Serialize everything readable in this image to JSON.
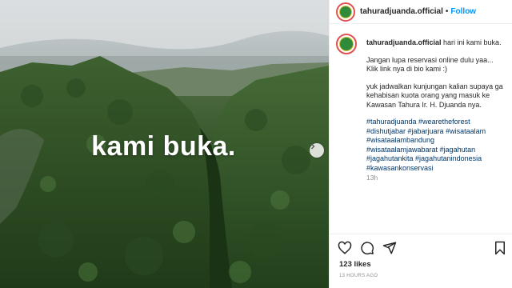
{
  "post": {
    "username": "tahuradjuanda.official",
    "follow_label": "Follow",
    "dot": "•",
    "overlay_text": "kami buka.",
    "caption": {
      "line1": "hari ini kami buka.",
      "para2": "Jangan lupa reservasi online dulu yaa... Klik link nya di bio kami :)",
      "para3": "yuk jadwalkan kunjungan kalian supaya ga kehabisan kuota orang yang masuk ke Kawasan Tahura Ir. H. Djuanda nya.",
      "hashtags": [
        "#tahuradjuanda #wearetheforest",
        "#dishutjabar #jabarjuara #wisataalam",
        "#wisataalambandung",
        "#wisataalamjawabarat #jagahutan",
        "#jagahutankita #jagahutanindonesia",
        "#kawasankonservasi"
      ],
      "time": "13h"
    },
    "likes": "123 likes",
    "time_ago": "13 HOURS AGO"
  },
  "icons": {
    "heart": "heart-icon",
    "comment": "comment-icon",
    "share": "share-icon",
    "save": "bookmark-icon",
    "next": "chevron-right-icon"
  },
  "colors": {
    "link_blue": "#0095f6",
    "hashtag": "#00376b",
    "forest": "#2c4a24"
  }
}
